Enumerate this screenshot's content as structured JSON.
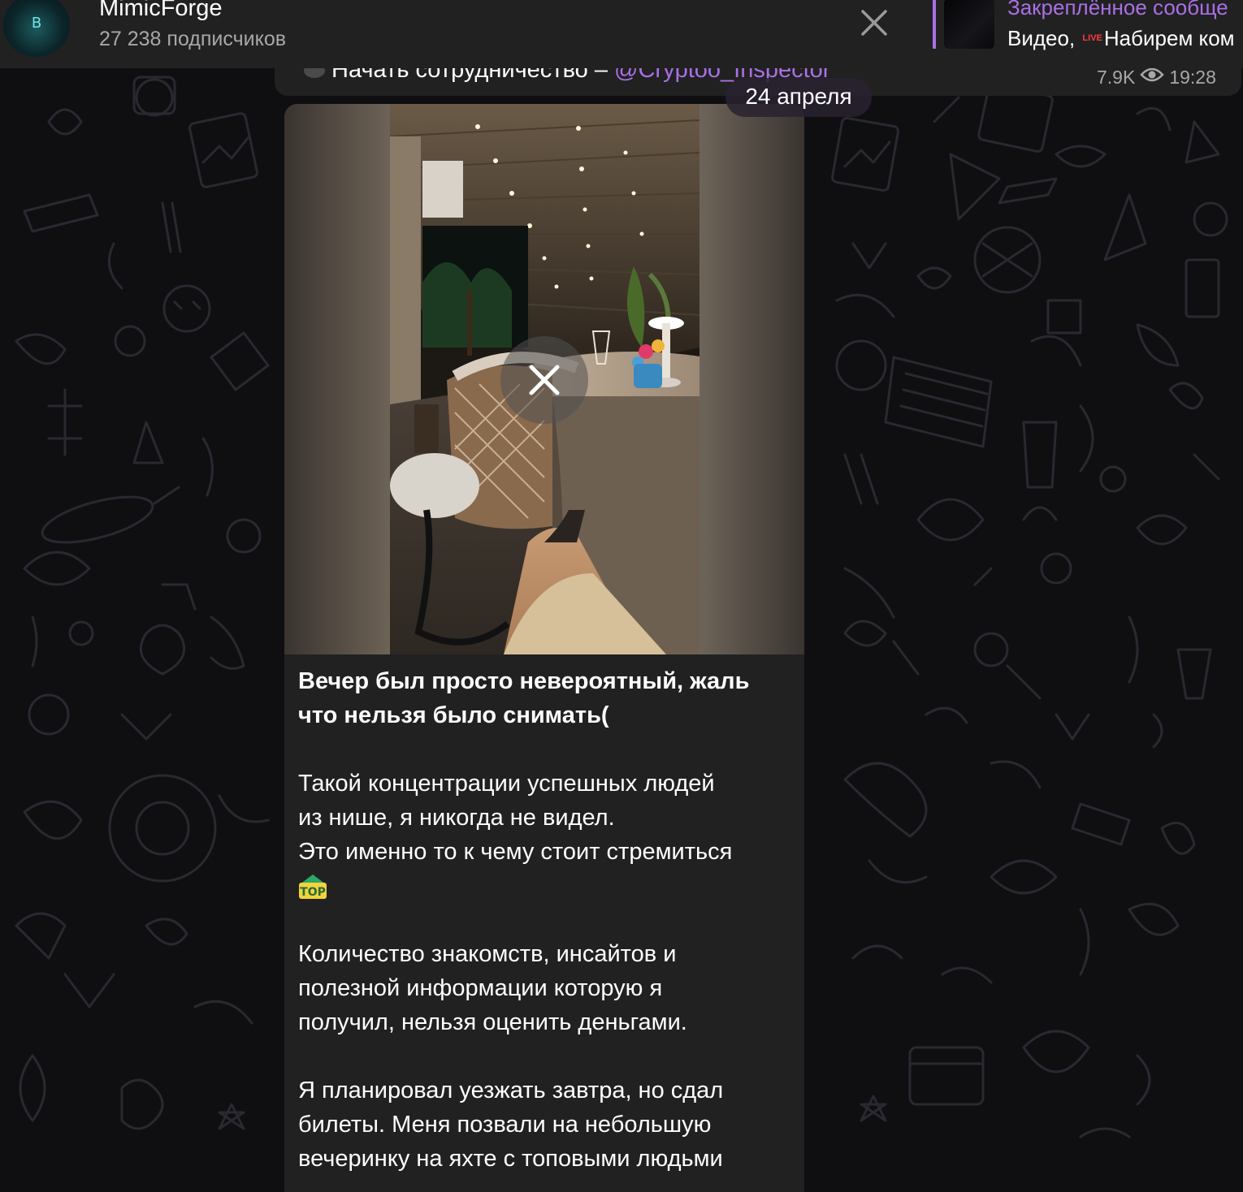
{
  "header": {
    "channel_name": "MimicForge",
    "subscribers": "27 238 подписчиков",
    "avatar_glyph": "B",
    "close_icon": "close-icon"
  },
  "pinned": {
    "title": "Закреплённое сообще",
    "prefix": "Видео,",
    "live_badge": "LIVE",
    "text": "Набирем ком"
  },
  "previous_message": {
    "text_prefix": "Начать сотрудничество –",
    "link": "@Cryptoo_Inspector",
    "views": "7.9K",
    "time": "19:28"
  },
  "date_separator": "24 апреля",
  "post": {
    "caption_bold_1": "Вечер был просто невероятный, жаль",
    "caption_bold_2": "что нельзя было снимать(",
    "line_1": "Такой концентрации успешных людей",
    "line_2": "из нише, я никогда не видел.",
    "line_3": "Это именно то к чему стоит стремиться",
    "top_emoji": "TOP",
    "line_4": "Количество знакомств, инсайтов и",
    "line_5": "полезной информации которую я",
    "line_6": "получил, нельзя оценить деньгами.",
    "line_7": "Я планировал уезжать завтра, но сдал",
    "line_8": "билеты. Меня позвали на небольшую",
    "line_9": "вечеринку на яхте с топовыми людьми"
  },
  "colors": {
    "accent": "#a970e6",
    "bubble": "#212121",
    "header": "#212121",
    "background": "#0f0f12",
    "secondary_text": "#a8a8a8"
  }
}
